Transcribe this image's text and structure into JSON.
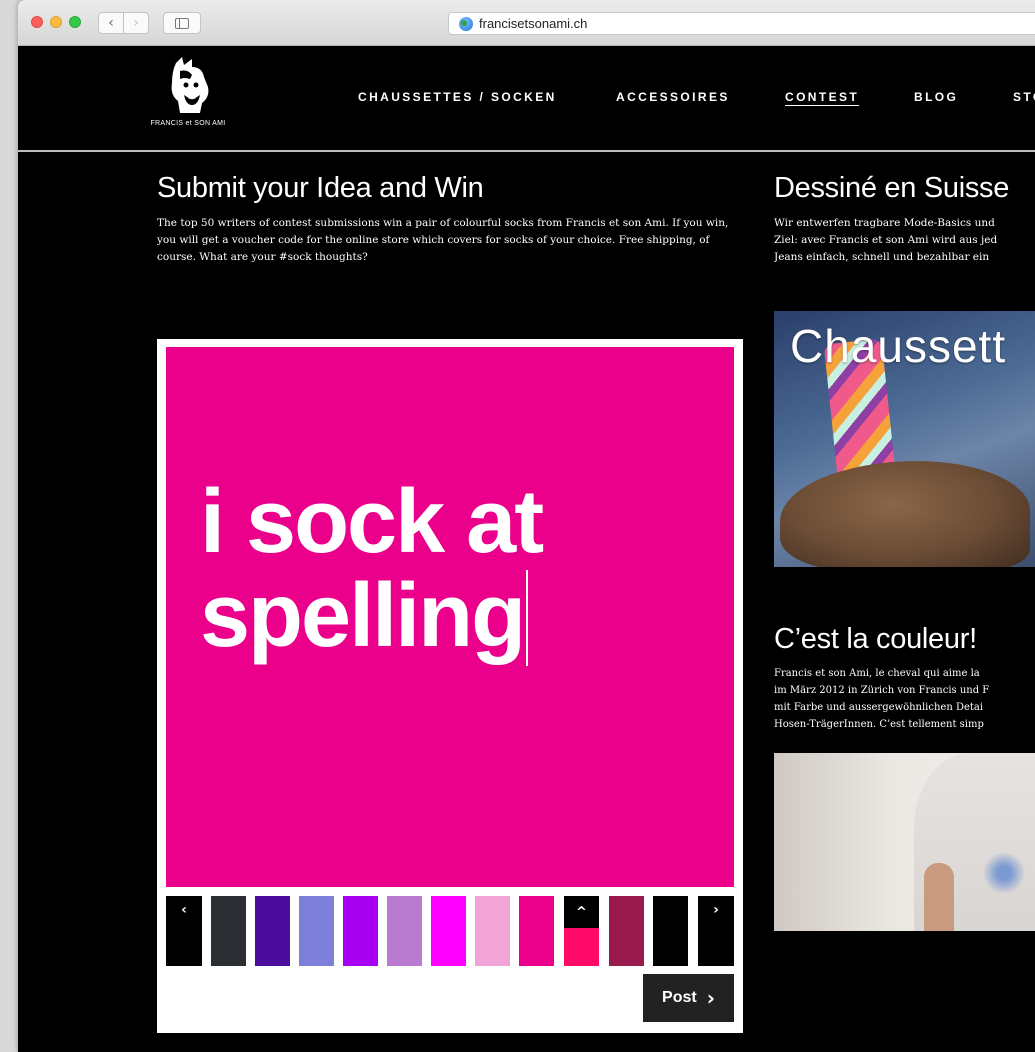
{
  "browser": {
    "url": "francisetsonami.ch",
    "back_glyph": "‹",
    "forward_glyph": "›"
  },
  "header": {
    "logo_text": "FRANCIS et SON AMI",
    "nav": [
      {
        "label": "CHAUSSETTES / SOCKEN",
        "active": false
      },
      {
        "label": "ACCESSOIRES",
        "active": false
      },
      {
        "label": "CONTEST",
        "active": true
      },
      {
        "label": "BLOG",
        "active": false
      },
      {
        "label": "STO",
        "active": false
      }
    ]
  },
  "contest": {
    "title": "Submit your Idea and Win",
    "description": "The top 50 writers of contest submissions win a pair of colourful socks from Francis et son Ami. If you win, you will get a voucher code for the online store which covers for socks of your choice. Free shipping, of course. What are your #sock thoughts?",
    "idea_text": "i sock at spelling",
    "canvas_color": "#eb008b",
    "palette": {
      "prev_glyph": "‹",
      "next_glyph": "›",
      "selected_glyph": "^",
      "selected_index": 9,
      "colors": [
        "#000000",
        "#2b2f33",
        "#4a0d9c",
        "#7d7fd8",
        "#a800f0",
        "#b87bd0",
        "#ff00ff",
        "#f2a4d6",
        "#eb008b",
        "#ff0a67",
        "#991a4d",
        "#000000"
      ]
    },
    "post_label": "Post",
    "post_glyph": "›"
  },
  "sidebar": {
    "section1": {
      "title": "Dessiné en Suisse",
      "text_lines": [
        "Wir entwerfen tragbare Mode-Basics und",
        "Ziel: avec Francis et son Ami wird aus jed",
        "Jeans einfach, schnell und bezahlbar ein"
      ]
    },
    "hero_caption": "Chaussett",
    "section2": {
      "title": "C’est la couleur!",
      "text_lines": [
        "Francis et son Ami, le cheval qui aime la",
        "im März 2012 in Zürich von Francis und F",
        "mit Farbe und aussergewöhnlichen Detai",
        "Hosen-TrägerInnen. C’est tellement simp"
      ]
    }
  },
  "colors": {
    "page_bg": "#000000",
    "accent_pink": "#eb008b",
    "post_button": "#222222"
  }
}
